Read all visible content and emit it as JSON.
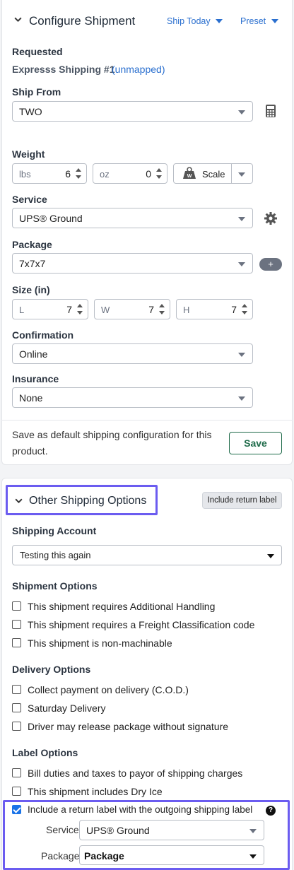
{
  "configure": {
    "title": "Configure Shipment",
    "ship_today": "Ship Today",
    "preset": "Preset",
    "requested_label": "Requested",
    "requested_value": "Expresss Shipping #1",
    "unmapped": "(unmapped)",
    "ship_from_label": "Ship From",
    "ship_from_value": "TWO",
    "weight_label": "Weight",
    "weight_lbs_unit": "lbs",
    "weight_lbs_value": "6",
    "weight_oz_unit": "oz",
    "weight_oz_value": "0",
    "scale_label": "Scale",
    "service_label": "Service",
    "service_value": "UPS® Ground",
    "package_label": "Package",
    "package_value": "7x7x7",
    "add_package": "+",
    "size_label": "Size (in)",
    "size_l_unit": "L",
    "size_l_value": "7",
    "size_w_unit": "W",
    "size_w_value": "7",
    "size_h_unit": "H",
    "size_h_value": "7",
    "confirmation_label": "Confirmation",
    "confirmation_value": "Online",
    "insurance_label": "Insurance",
    "insurance_value": "None",
    "save_default_text_1": "Save as default shipping configuration for this",
    "save_default_text_2": "product.",
    "save_button": "Save"
  },
  "other": {
    "title": "Other Shipping Options",
    "include_return_button": "Include return label",
    "account_label": "Shipping Account",
    "account_value": "Testing this again",
    "shipment_options_label": "Shipment Options",
    "shipment_options": [
      "This shipment requires Additional Handling",
      "This shipment requires a Freight Classification code",
      "This shipment is non-machinable"
    ],
    "delivery_options_label": "Delivery Options",
    "delivery_options": [
      "Collect payment on delivery (C.O.D.)",
      "Saturday Delivery",
      "Driver may release package without signature"
    ],
    "label_options_label": "Label Options",
    "label_options": [
      "Bill duties and taxes to payor of shipping charges",
      "This shipment includes Dry Ice"
    ],
    "return_label_checkbox": "Include a return label with the outgoing shipping label",
    "return_checked": true,
    "return_service_label": "Service",
    "return_service_value": "UPS® Ground",
    "return_package_label": "Package",
    "return_package_value": "Package",
    "help_icon_glyph": "?"
  },
  "colors": {
    "link": "#2a6fcf",
    "highlight": "#6b5cf0",
    "save_border": "#1f6b4a",
    "checkbox_on": "#1a73e8"
  }
}
